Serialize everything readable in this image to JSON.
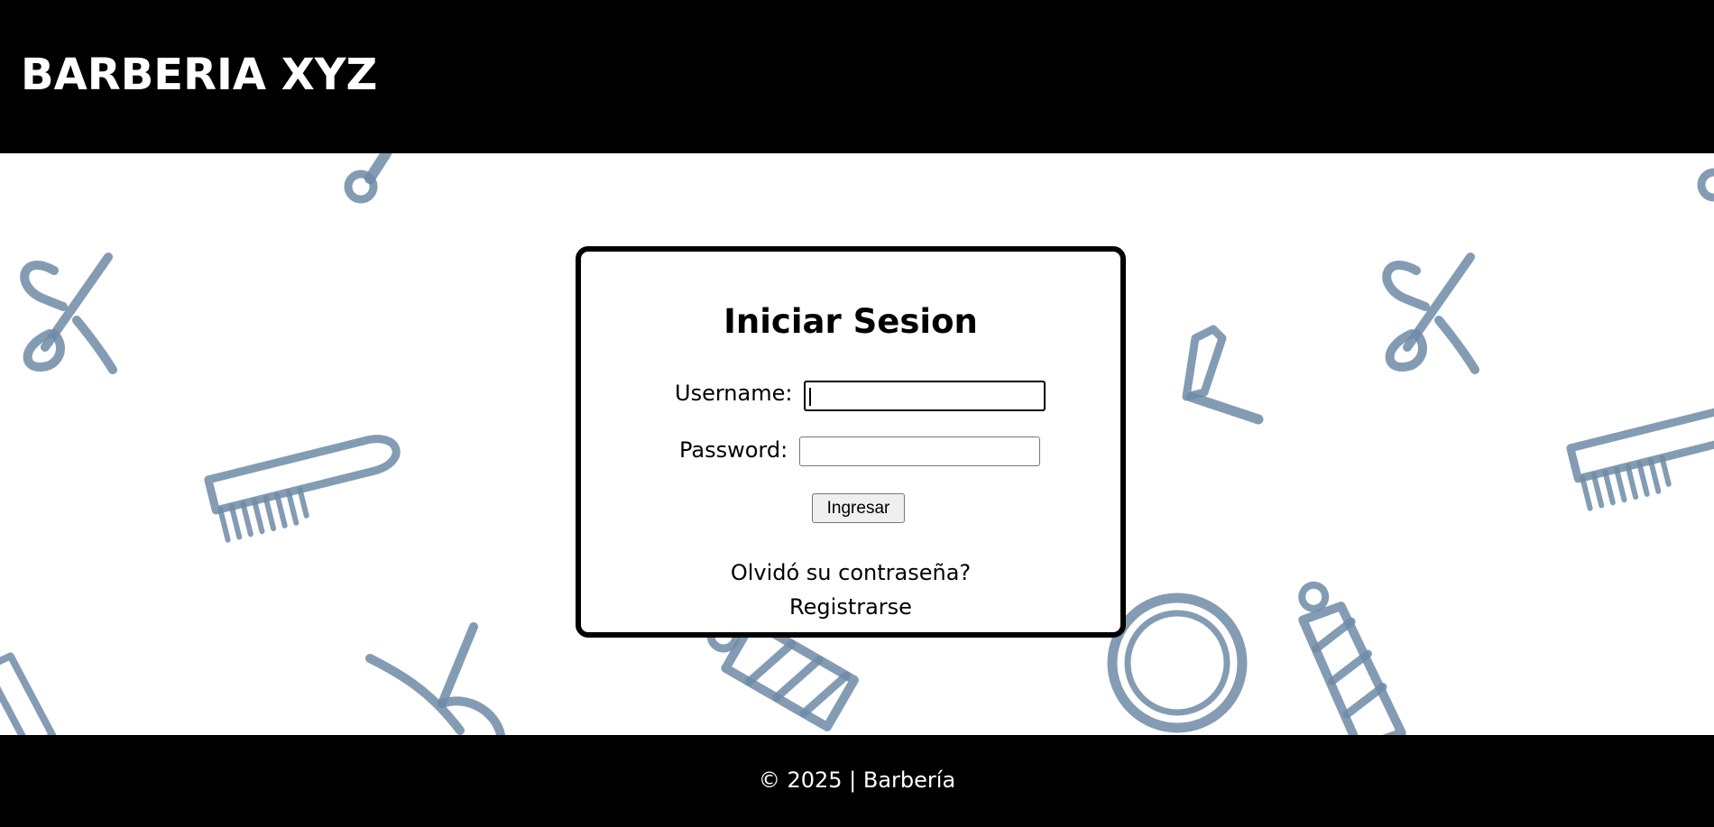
{
  "header": {
    "brand": "BARBERIA XYZ",
    "background": "#000000"
  },
  "login": {
    "title": "Iniciar Sesion",
    "username_label": "Username:",
    "username_value": "",
    "password_label": "Password:",
    "password_value": "",
    "submit_label": "Ingresar",
    "forgot_link": "Olvidó su contraseña?",
    "register_link": "Registrarse"
  },
  "footer": {
    "text": "© 2025 | Barbería"
  },
  "theme": {
    "pattern_color": "#6f8ba6",
    "card_border": "#000000"
  },
  "background_icons": [
    "scissors-icon",
    "comb-icon",
    "razor-icon",
    "mirror-icon",
    "barber-pole-icon",
    "key-icon"
  ]
}
